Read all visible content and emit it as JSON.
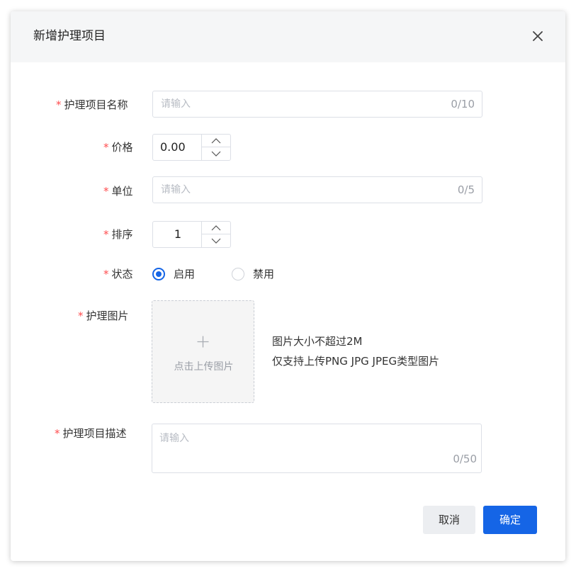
{
  "dialog": {
    "title": "新增护理项目",
    "close_icon": "close-icon"
  },
  "form": {
    "name": {
      "label": "护理项目名称",
      "placeholder": "请输入",
      "counter": "0/10"
    },
    "price": {
      "label": "价格",
      "value": "0.00"
    },
    "unit": {
      "label": "单位",
      "placeholder": "请输入",
      "counter": "0/5"
    },
    "sort": {
      "label": "排序",
      "value": "1"
    },
    "status": {
      "label": "状态",
      "options": [
        "启用",
        "禁用"
      ],
      "selected": "启用"
    },
    "image": {
      "label": "护理图片",
      "upload_text": "点击上传图片",
      "hint_size": "图片大小不超过2M",
      "hint_types": "仅支持上传PNG JPG JPEG类型图片"
    },
    "description": {
      "label": "护理项目描述",
      "placeholder": "请输入",
      "counter": "0/50"
    },
    "required_mark": "*"
  },
  "footer": {
    "cancel_label": "取消",
    "confirm_label": "确定"
  },
  "colors": {
    "primary": "#1565e6",
    "required": "#ff4d4f",
    "header_bg": "#f5f6f7"
  }
}
